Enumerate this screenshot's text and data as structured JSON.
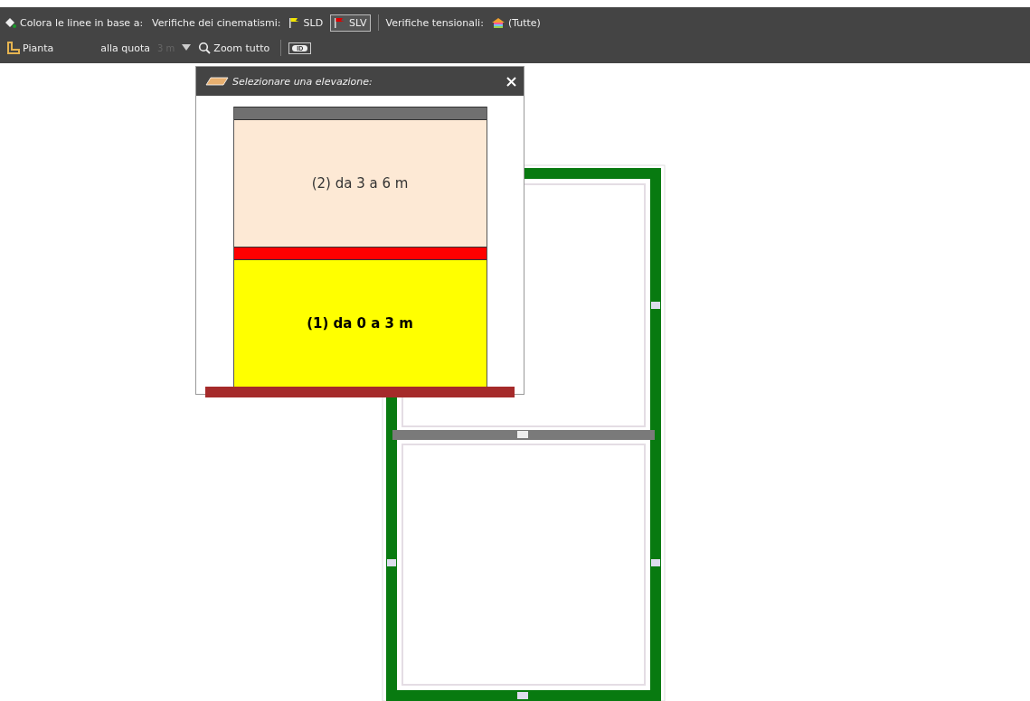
{
  "toolbar": {
    "color_by_label": "Colora le linee in base a:",
    "kinematic_label": "Verifiche dei cinematismi:",
    "kinematic_buttons": [
      {
        "label": "SLD",
        "color": "#f2e600",
        "selected": false
      },
      {
        "label": "SLV",
        "color": "#e00000",
        "selected": true
      }
    ],
    "tension_label": "Verifiche tensionali:",
    "tension_value": "(Tutte)",
    "view_button": "Pianta",
    "quota_label": "alla quota",
    "quota_field": {
      "value": "3 m",
      "disabled": true
    },
    "zoom_button": "Zoom tutto",
    "id_toggle": {
      "label": "ID",
      "on": false
    }
  },
  "elevation_popup": {
    "title": "Selezionare una elevazione:",
    "storeys": [
      {
        "label": "(2) da 3 a 6 m",
        "color": "#fde9d5",
        "selected": false
      },
      {
        "label": "(1) da 0 a 3 m",
        "color": "#ffff00",
        "selected": true
      }
    ]
  }
}
